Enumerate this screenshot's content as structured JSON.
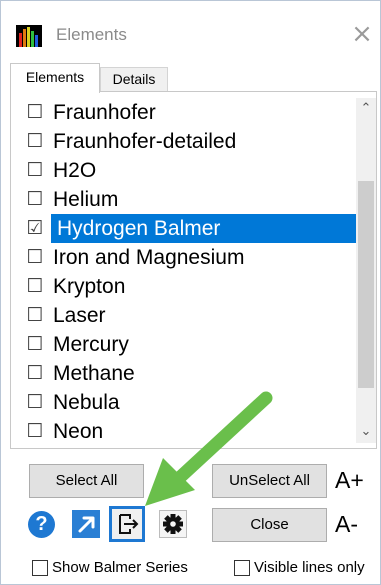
{
  "window": {
    "title": "Elements",
    "close_glyph": "×"
  },
  "tabs": [
    {
      "label": "Elements",
      "active": true
    },
    {
      "label": "Details",
      "active": false
    }
  ],
  "elements_list": {
    "items": [
      {
        "label": "Fraunhofer",
        "checked": false,
        "selected": false
      },
      {
        "label": "Fraunhofer-detailed",
        "checked": false,
        "selected": false
      },
      {
        "label": "H2O",
        "checked": false,
        "selected": false
      },
      {
        "label": "Helium",
        "checked": false,
        "selected": false
      },
      {
        "label": "Hydrogen Balmer",
        "checked": true,
        "selected": true
      },
      {
        "label": "Iron and Magnesium",
        "checked": false,
        "selected": false
      },
      {
        "label": "Krypton",
        "checked": false,
        "selected": false
      },
      {
        "label": "Laser",
        "checked": false,
        "selected": false
      },
      {
        "label": "Mercury",
        "checked": false,
        "selected": false
      },
      {
        "label": "Methane",
        "checked": false,
        "selected": false
      },
      {
        "label": "Nebula",
        "checked": false,
        "selected": false
      },
      {
        "label": "Neon",
        "checked": false,
        "selected": false
      }
    ],
    "checked_glyph": "☑",
    "unchecked_glyph": "☐",
    "scroll_up_glyph": "⌃",
    "scroll_down_glyph": "⌄"
  },
  "buttons": {
    "select_all": "Select All",
    "unselect_all": "UnSelect All",
    "close": "Close",
    "font_increase": "A+",
    "font_decrease": "A-"
  },
  "toolbar_icons": {
    "help": "help-icon",
    "help_glyph": "?",
    "link": "link-icon",
    "export": "export-icon",
    "settings": "gear-icon"
  },
  "options": {
    "show_balmer_series": {
      "label": "Show Balmer Series",
      "checked": false
    },
    "visible_lines_only": {
      "label": "Visible lines only",
      "checked": false
    }
  },
  "colors": {
    "selection": "#0078d7",
    "accent_blue": "#1e78d2",
    "annotation_arrow": "#6abf4b"
  }
}
